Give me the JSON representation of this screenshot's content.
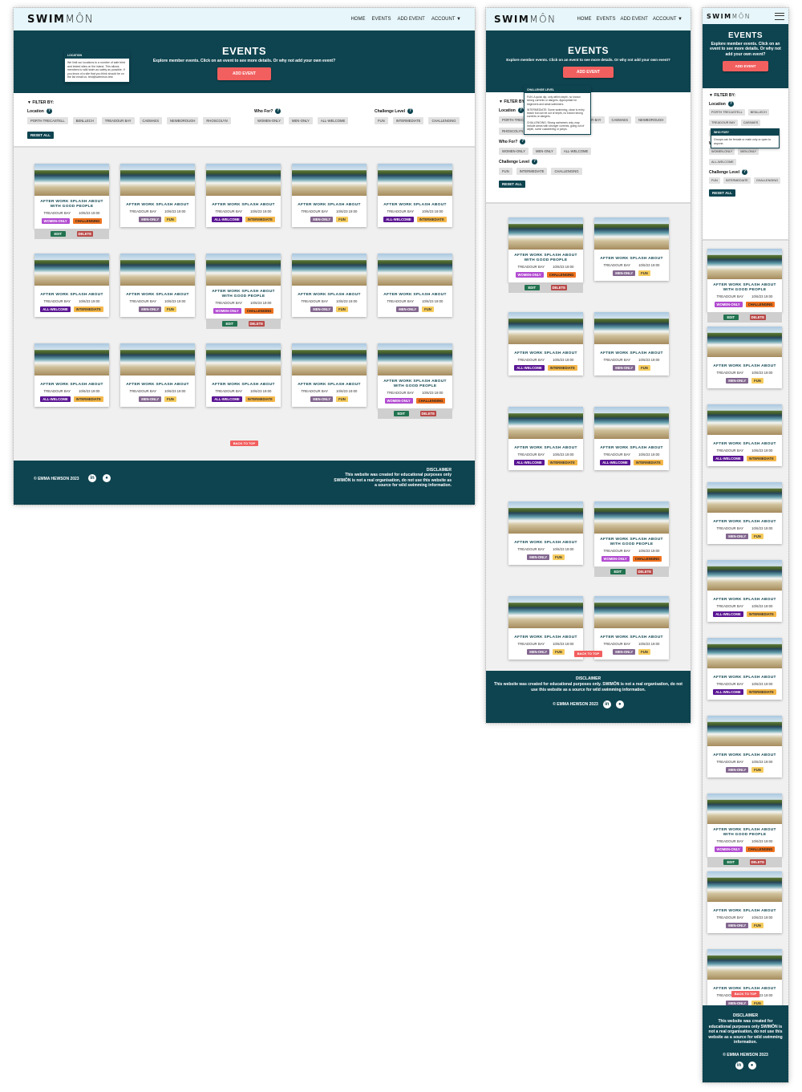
{
  "brand": {
    "bold": "SWIM",
    "light": "MÔN"
  },
  "nav": {
    "home": "HOME",
    "events": "EVENTS",
    "add_event": "ADD EVENT",
    "account": "ACCOUNT ▼"
  },
  "hero": {
    "title": "EVENTS",
    "subtitle": "Explore member events. Click on an event to see more details. Or why not add your own event?",
    "add_button": "ADD EVENT"
  },
  "filter": {
    "title": "FILTER BY:",
    "location_label": "Location",
    "who_label": "Who For?",
    "challenge_label": "Challenge Level",
    "reset": "RESET ALL",
    "locations": [
      "PORTH TRECASTELL",
      "BENLLECH",
      "TREADOUR BAY",
      "CAEMAES",
      "NEWBOROUGH",
      "RHOSCOLYN"
    ],
    "who": [
      "WOMEN-ONLY",
      "MEN-ONLY",
      "ALL-WELCOME"
    ],
    "challenge": [
      "FUN",
      "INTERMEDIATE",
      "CHALLENGING"
    ]
  },
  "tooltips": {
    "location": {
      "title": "LOCATION",
      "body": "We limit our locations to a number of safe tried and tested sites on the island. This allows members to wild swim as safely as possible. If you know of a site that you think should be on the list email us. test@swimmon.test"
    },
    "challenge": {
      "title": "CHALLENGE LEVEL",
      "fun": "FUN: A quick dip, only within depth, no known strong currents or dangers. Appropriate for beginners and weak swimmers.",
      "intermediate": "INTERMEDIATE: Some swimming, close to entry beach but can be out of depth, no known strong currents or dangers.",
      "challenging": "CHALLENGING: Strong swimmers only, may include areas with stronger currents, going out of depth, some coasteering or jumps."
    },
    "who": {
      "title": "WHO FOR?",
      "body": "Groups can be female or male only or open to anyone."
    }
  },
  "card": {
    "title_short": "AFTER WORK SPLASH ABOUT",
    "title_long": "AFTER WORK SPLASH ABOUT WITH GOOD PEOPLE",
    "location": "TREADOUR BAY",
    "date": "10/6/23 19:00",
    "edit": "EDIT",
    "delete": "DELETE"
  },
  "tags": {
    "women": "WOMEN-ONLY",
    "men": "MEN-ONLY",
    "all": "ALL-WELCOME",
    "int": "INTERMEDIATE",
    "fun": "FUN",
    "chal": "CHALLENGING"
  },
  "events": [
    {
      "long": true,
      "who": "women",
      "level": "chal",
      "own": true
    },
    {
      "long": false,
      "who": "men",
      "level": "fun",
      "own": false
    },
    {
      "long": false,
      "who": "all",
      "level": "int",
      "own": false
    },
    {
      "long": false,
      "who": "men",
      "level": "fun",
      "own": false
    },
    {
      "long": false,
      "who": "all",
      "level": "int",
      "own": false
    },
    {
      "long": false,
      "who": "all",
      "level": "int",
      "own": false
    },
    {
      "long": false,
      "who": "men",
      "level": "fun",
      "own": false
    },
    {
      "long": true,
      "who": "women",
      "level": "chal",
      "own": true
    },
    {
      "long": false,
      "who": "men",
      "level": "fun",
      "own": false
    },
    {
      "long": false,
      "who": "men",
      "level": "fun",
      "own": false
    },
    {
      "long": false,
      "who": "all",
      "level": "int",
      "own": false
    },
    {
      "long": false,
      "who": "men",
      "level": "fun",
      "own": false
    },
    {
      "long": false,
      "who": "all",
      "level": "int",
      "own": false
    },
    {
      "long": false,
      "who": "men",
      "level": "fun",
      "own": false
    },
    {
      "long": true,
      "who": "women",
      "level": "chal",
      "own": true
    }
  ],
  "back_to_top": "BACK TO TOP",
  "footer": {
    "copyright": "© EMMA HEWSON 2023",
    "disclaimer_title": "DISCLAIMER",
    "disclaimer": "This website was created for educational purposes only SWIMÔN is not a real organisation, do not use this website as a source for wild swimming information.",
    "disclaimer_tablet": "This website was created for educational purposes only. SWIMÔN is not a real organisation, do not use this website as a source for wild swimming information.",
    "linkedin": "in",
    "github": "●"
  },
  "colors": {
    "primary": "#0e4450",
    "accent": "#f25f5f",
    "nav_bg": "#e6f6fa"
  }
}
